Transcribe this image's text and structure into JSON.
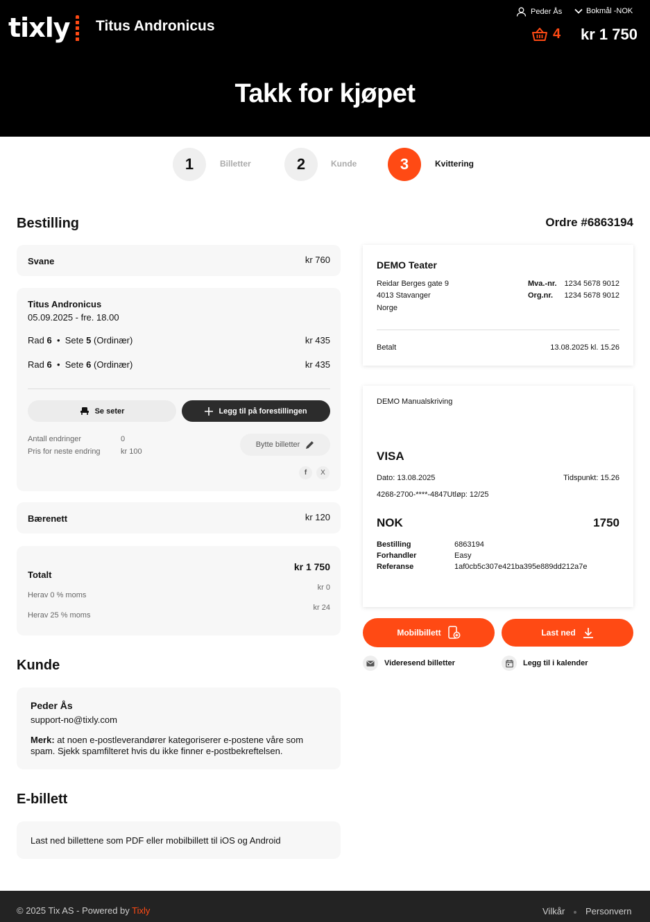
{
  "header": {
    "logo": "tixly",
    "event_title": "Titus Andronicus",
    "user_name": "Peder Ås",
    "language": "Bokmål -NOK",
    "cart_count": "4",
    "cart_total": "kr 1 750",
    "page_title": "Takk for kjøpet",
    "accent": "#ff4a14"
  },
  "steps": [
    {
      "number": "1",
      "label": "Billetter"
    },
    {
      "number": "2",
      "label": "Kunde"
    },
    {
      "number": "3",
      "label": "Kvittering"
    }
  ],
  "order": {
    "heading": "Bestilling",
    "order_number": "Ordre #6863194",
    "item1": {
      "name": "Svane",
      "price": "kr 760"
    },
    "event": {
      "name": "Titus Andronicus",
      "date": "05.09.2025 - fre. 18.00",
      "seats": [
        {
          "rad_label": "Rad",
          "rad": "6",
          "sete_label": "Sete",
          "sete": "5",
          "type": "(Ordinær)",
          "price": "kr 435"
        },
        {
          "rad_label": "Rad",
          "rad": "6",
          "sete_label": "Sete",
          "sete": "6",
          "type": "(Ordinær)",
          "price": "kr 435"
        }
      ],
      "see_seats": "Se seter",
      "add_to_show": "Legg til på forestillingen",
      "changes_label": "Antall endringer",
      "changes_value": "0",
      "next_change_label": "Pris for neste endring",
      "next_change_value": "kr 100",
      "swap_tickets": "Bytte billetter",
      "share_fb": "f",
      "share_x": "X"
    },
    "item3": {
      "name": "Bærenett",
      "price": "kr 120"
    },
    "total": {
      "label": "Totalt",
      "value": "kr 1 750",
      "vat0_label": "Herav 0 % moms",
      "vat0_value": "kr 0",
      "vat25_label": "Herav 25 % moms",
      "vat25_value": "kr 24"
    }
  },
  "customer": {
    "heading": "Kunde",
    "name": "Peder Ås",
    "email": "support-no@tixly.com",
    "note_bold": "Merk:",
    "note_text": " at noen e-postleverandører kategoriserer e-postene våre som spam. Sjekk spamfilteret hvis du ikke finner e-postbekreftelsen."
  },
  "eticket": {
    "heading": "E-billett",
    "text": "Last ned billettene som PDF eller mobilbillett til iOS og Android"
  },
  "receipt": {
    "company": "DEMO Teater",
    "address1": "Reidar Berges gate 9",
    "address2": "4013 Stavanger",
    "address3": "Norge",
    "mva_label": "Mva.-nr.",
    "mva_value": "1234 5678 9012",
    "org_label": "Org.nr.",
    "org_value": "1234 5678 9012",
    "paid_label": "Betalt",
    "paid_value": "13.08.2025 kl. 15.26"
  },
  "payment": {
    "method_title": "DEMO Manualskriving",
    "card_type": "VISA",
    "date": "Dato: 13.08.2025",
    "time": "Tidspunkt: 15.26",
    "card_number": "4268-2700-****-4847Utløp: 12/25",
    "currency": "NOK",
    "amount": "1750",
    "rows": [
      {
        "label": "Bestilling",
        "value": "6863194"
      },
      {
        "label": "Forhandler",
        "value": "Easy"
      },
      {
        "label": "Referanse",
        "value": "1af0cb5c307e421ba395e889dd212a7e"
      }
    ]
  },
  "actions": {
    "mobile_ticket": "Mobilbillett",
    "download": "Last ned",
    "forward": "Videresend billetter",
    "calendar": "Legg til i kalender"
  },
  "footer": {
    "copyright": "© 2025 Tix AS - Powered by ",
    "brand": "Tixly",
    "terms": "Vilkår",
    "privacy": "Personvern"
  }
}
